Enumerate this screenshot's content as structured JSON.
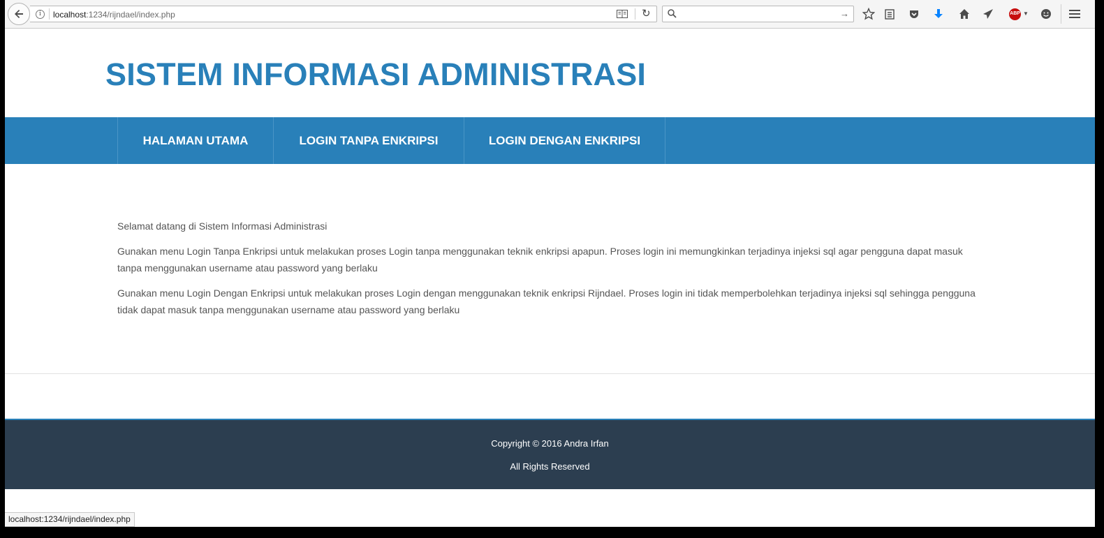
{
  "browser": {
    "url_host": "localhost",
    "url_path": ":1234/rijndael/index.php",
    "search_placeholder": "",
    "status_text": "localhost:1234/rijndael/index.php"
  },
  "site": {
    "title": "SISTEM INFORMASI ADMINISTRASI",
    "brand_color": "#2980b9",
    "footer_color": "#2c3e50"
  },
  "nav": {
    "items": [
      {
        "label": "HALAMAN UTAMA"
      },
      {
        "label": "LOGIN TANPA ENKRIPSI"
      },
      {
        "label": "LOGIN DENGAN ENKRIPSI"
      }
    ]
  },
  "content": {
    "paragraphs": [
      "Selamat datang di Sistem Informasi Administrasi",
      "Gunakan menu Login Tanpa Enkripsi untuk melakukan proses Login tanpa menggunakan teknik enkripsi apapun. Proses login ini memungkinkan terjadinya injeksi sql agar pengguna dapat masuk tanpa menggunakan username atau password yang berlaku",
      "Gunakan menu Login Dengan Enkripsi untuk melakukan proses Login dengan menggunakan teknik enkripsi Rijndael. Proses login ini tidak memperbolehkan terjadinya injeksi sql sehingga pengguna tidak dapat masuk tanpa menggunakan username atau password yang berlaku"
    ]
  },
  "footer": {
    "copyright": "Copyright © 2016 Andra Irfan",
    "rights": "All Rights Reserved"
  }
}
